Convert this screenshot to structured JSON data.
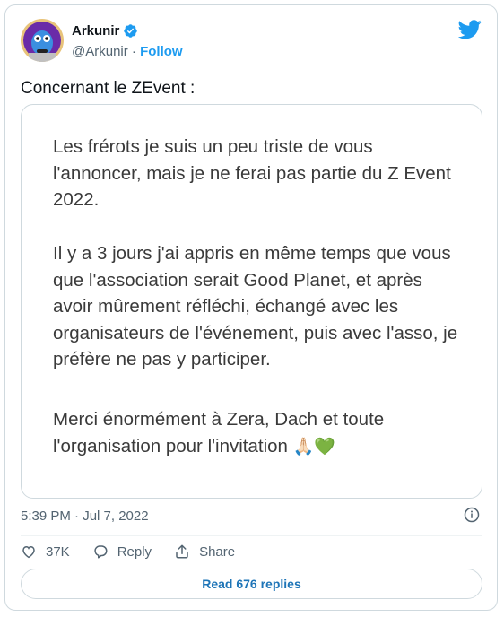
{
  "author": {
    "name": "Arkunir",
    "handle": "@Arkunir",
    "separator": "·",
    "follow_label": "Follow",
    "verified_icon": "verified-badge-icon",
    "avatar_icon": "avatar"
  },
  "tweet": {
    "text": "Concernant le ZEvent :",
    "image_paragraphs": [
      "Les frérots je suis un peu triste de vous l'annoncer, mais je ne ferai pas partie du Z Event 2022.",
      "Il y a 3 jours j'ai appris en même temps que vous que l'association serait Good Planet, et après avoir mûrement réfléchi, échangé avec les organisateurs de l'événement, puis avec l'asso, je préfère ne pas y participer.",
      "Merci énormément à Zera, Dach et toute l'organisation pour l'invitation"
    ],
    "emojis": "🙏🏻💚",
    "timestamp": "5:39 PM · Jul 7, 2022"
  },
  "actions": {
    "likes_count": "37K",
    "reply_label": "Reply",
    "share_label": "Share",
    "read_replies_label": "Read 676 replies"
  },
  "colors": {
    "accent": "#1d9bf0",
    "link_text": "#1d74b7",
    "secondary_text": "#536471",
    "border": "#cfd9de"
  }
}
